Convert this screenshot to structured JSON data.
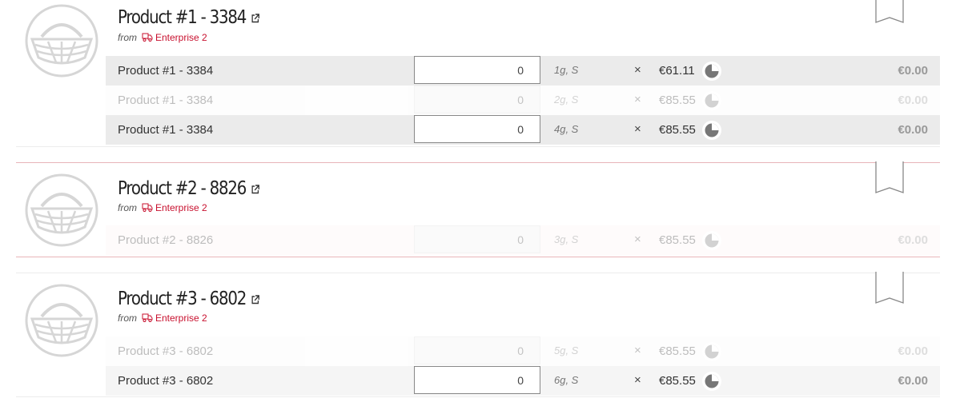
{
  "products": [
    {
      "title": "Product #1 - 3384",
      "from_label": "from",
      "supplier": "Enterprise 2",
      "variants": [
        {
          "name": "Product #1 - 3384",
          "quantity": "0",
          "unit": "1g, S",
          "times": "×",
          "price": "€61.11",
          "total": "€0.00",
          "state": "active"
        },
        {
          "name": "Product #1 - 3384",
          "quantity": "0",
          "unit": "2g, S",
          "times": "×",
          "price": "€85.55",
          "total": "€0.00",
          "state": "disabled"
        },
        {
          "name": "Product #1 - 3384",
          "quantity": "0",
          "unit": "4g, S",
          "times": "×",
          "price": "€85.55",
          "total": "€0.00",
          "state": "active"
        }
      ]
    },
    {
      "title": "Product #2 - 8826",
      "from_label": "from",
      "supplier": "Enterprise 2",
      "variants": [
        {
          "name": "Product #2 - 8826",
          "quantity": "0",
          "unit": "3g, S",
          "times": "×",
          "price": "€85.55",
          "total": "€0.00",
          "state": "disabled"
        }
      ]
    },
    {
      "title": "Product #3 - 6802",
      "from_label": "from",
      "supplier": "Enterprise 2",
      "variants": [
        {
          "name": "Product #3 - 6802",
          "quantity": "0",
          "unit": "5g, S",
          "times": "×",
          "price": "€85.55",
          "total": "€0.00",
          "state": "disabled"
        },
        {
          "name": "Product #3 - 6802",
          "quantity": "0",
          "unit": "6g, S",
          "times": "×",
          "price": "€85.55",
          "total": "€0.00",
          "state": "active"
        }
      ]
    }
  ],
  "icons": {
    "logo": "basket-icon",
    "external": "external-link-icon",
    "supplier": "truck-icon",
    "bookmark": "bookmark-icon",
    "delivery": "pie-clock-icon"
  },
  "colors": {
    "accent": "#c8102e",
    "active_row": "#ebebeb",
    "muted_text": "#999999"
  }
}
